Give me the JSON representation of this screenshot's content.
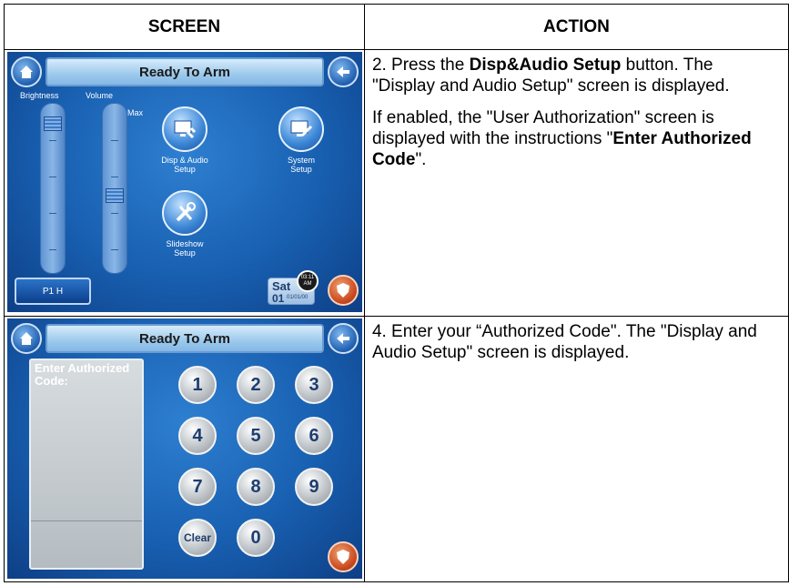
{
  "headers": {
    "screen": "SCREEN",
    "action": "ACTION"
  },
  "row1": {
    "screen": {
      "title": "Ready To Arm",
      "slider_labels": {
        "brightness": "Brightness",
        "volume": "Volume",
        "max": "Max"
      },
      "buttons": [
        {
          "label": "Disp & Audio\nSetup",
          "icon": "monitor-audio-icon"
        },
        {
          "label": "System\nSetup",
          "icon": "monitor-tools-icon"
        },
        {
          "label": "Slideshow\nSetup",
          "icon": "wrench-icon"
        }
      ],
      "partition_button": "P1 H",
      "date": {
        "day": "Sat",
        "num": "01",
        "full": "01/01/00"
      },
      "clock": {
        "time": "03:11",
        "ampm": "AM"
      },
      "levels": {
        "brightness": 1.0,
        "volume": 0.45
      }
    },
    "action": {
      "p1_pre": "2.  Press the ",
      "p1_bold": "Disp&Audio Setup",
      "p1_post": " button. The \"Display and Audio Setup\" screen is displayed.",
      "p2_pre": "If enabled, the \"User Authorization\" screen is displayed with the instructions \"",
      "p2_bold": "Enter Authorized Code",
      "p2_post": "\"."
    }
  },
  "row2": {
    "screen": {
      "title": "Ready To Arm",
      "code_label": "Enter Authorized Code:",
      "keys": [
        "1",
        "2",
        "3",
        "4",
        "5",
        "6",
        "7",
        "8",
        "9",
        "Clear",
        "0"
      ]
    },
    "action": {
      "p1": "4.  Enter your “Authorized Code\".  The \"Display and Audio Setup\" screen is displayed."
    }
  }
}
